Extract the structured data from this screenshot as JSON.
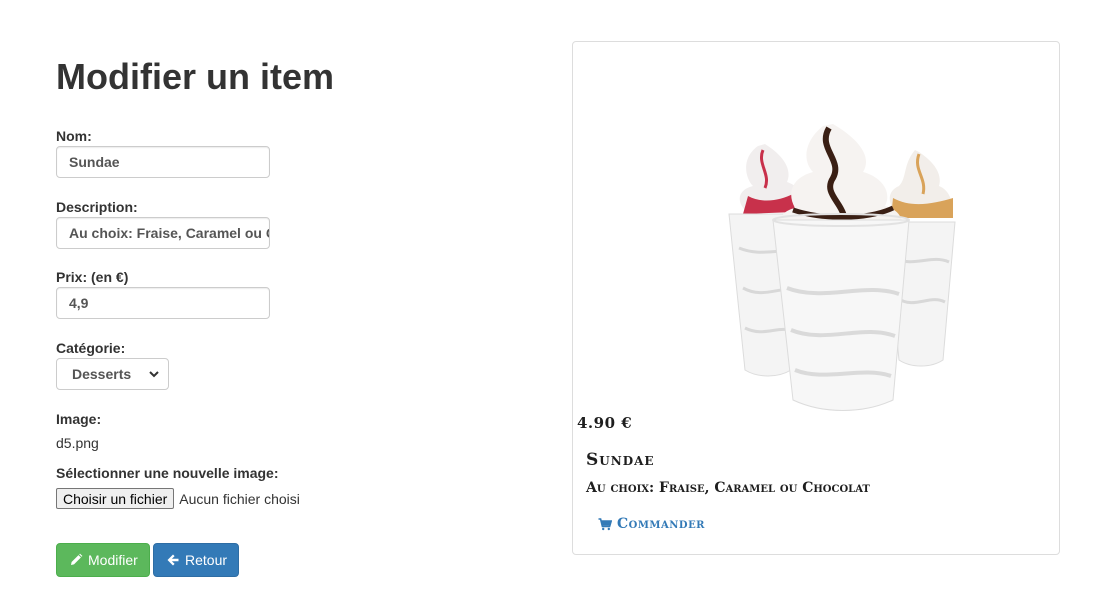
{
  "page": {
    "title": "Modifier un item"
  },
  "form": {
    "name_label": "Nom:",
    "name_value": "Sundae",
    "description_label": "Description:",
    "description_value": "Au choix: Fraise, Caramel ou Chocolat",
    "price_label": "Prix: (en €)",
    "price_value": "4,9",
    "category_label": "Catégorie:",
    "category_selected": "Desserts",
    "image_label": "Image:",
    "image_filename": "d5.png",
    "new_image_label": "Sélectionner une nouvelle image:",
    "file_button_label": "Choisir un fichier",
    "file_status": "Aucun fichier choisi"
  },
  "buttons": {
    "modify_label": "Modifier",
    "back_label": "Retour"
  },
  "preview": {
    "price": "4.90 €",
    "name": "Sundae",
    "description": "Au choix: Fraise, Caramel ou Chocolat",
    "order_label": "Commander"
  },
  "colors": {
    "success": "#5cb85c",
    "primary": "#337ab7",
    "text": "#333333"
  },
  "icons": {
    "modify": "pencil-icon",
    "back": "arrow-left-icon",
    "order": "shopping-cart-icon",
    "select": "chevron-down-icon"
  }
}
